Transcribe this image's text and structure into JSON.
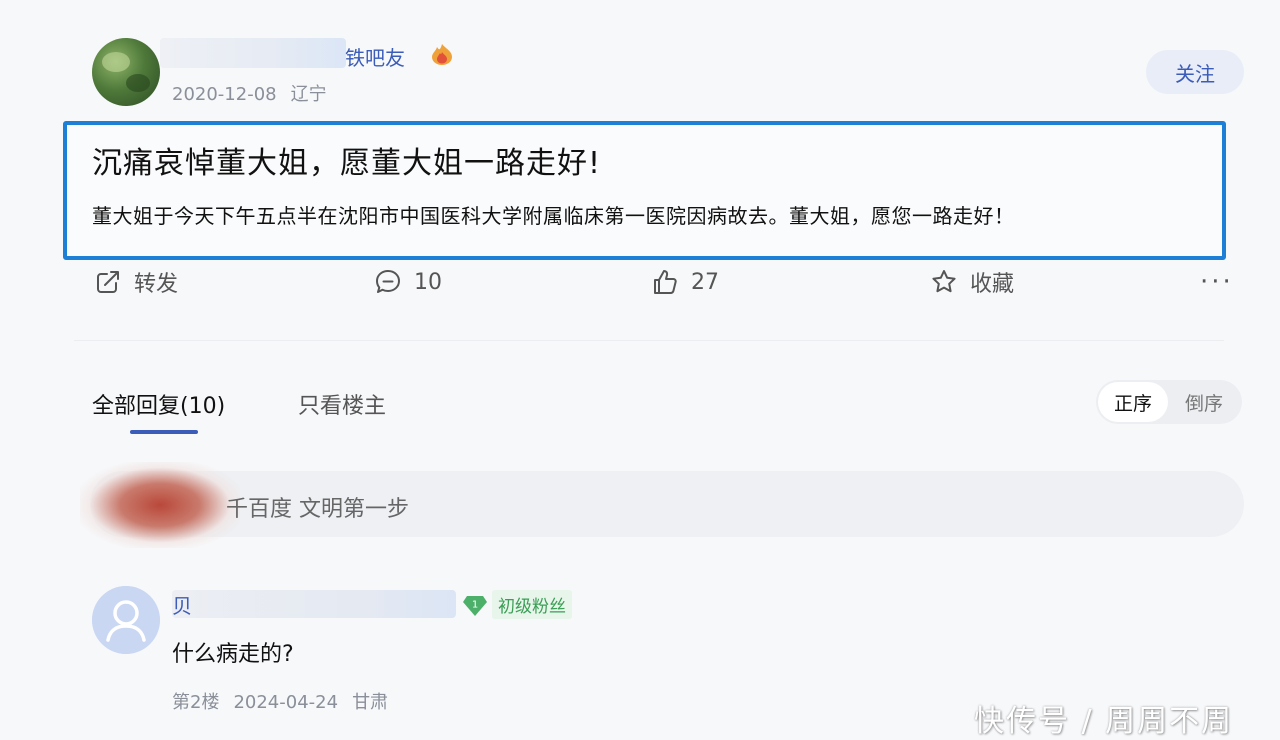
{
  "post": {
    "author_name_suffix": "铁吧友",
    "date": "2020-12-08",
    "location": "辽宁",
    "follow_label": "关注",
    "title": "沉痛哀悼董大姐，愿董大姐一路走好!",
    "body": "董大姐于今天下午五点半在沈阳市中国医科大学附属临床第一医院因病故去。董大姐，愿您一路走好！",
    "icons": {
      "level": "flame-badge-icon"
    }
  },
  "actions": {
    "share_label": "转发",
    "comment_count": "10",
    "like_count": "27",
    "favorite_label": "收藏",
    "more_label": "···",
    "icons": [
      "share-icon",
      "comment-icon",
      "thumbs-up-icon",
      "star-icon",
      "more-icon"
    ]
  },
  "tabs": {
    "all_label": "全部回复(10)",
    "owner_only_label": "只看楼主"
  },
  "sort": {
    "asc_label": "正序",
    "desc_label": "倒序"
  },
  "reply_input": {
    "placeholder": "千百度 文明第一步"
  },
  "comments": [
    {
      "name_prefix": "贝",
      "badge_level": "1",
      "badge_label": "初级粉丝",
      "text": "什么病走的?",
      "floor": "第2楼",
      "date": "2024-04-24",
      "location": "甘肃"
    }
  ],
  "watermark": "快传号 / 周周不周",
  "colors": {
    "accent": "#3b5cb8",
    "highlight_border": "#1d7fd6",
    "fan_badge": "#3a9e55"
  }
}
